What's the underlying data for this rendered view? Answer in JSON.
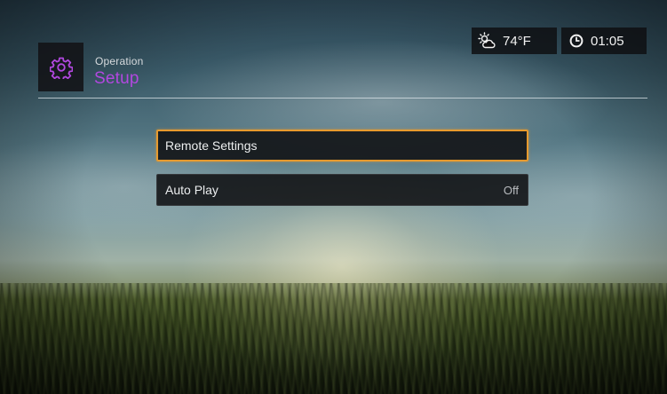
{
  "header": {
    "parent_label": "Operation",
    "current_label": "Setup",
    "app_icon": "gear-icon",
    "accent_color": "#b248e0"
  },
  "status": {
    "weather_icon": "partly-cloudy-icon",
    "temperature": "74°F",
    "clock_icon": "clock-icon",
    "time": "01:05"
  },
  "menu": {
    "selected_border_color": "#e79a2e",
    "items": [
      {
        "label": "Remote Settings",
        "value": "",
        "selected": true
      },
      {
        "label": "Auto Play",
        "value": "Off",
        "selected": false
      }
    ]
  }
}
